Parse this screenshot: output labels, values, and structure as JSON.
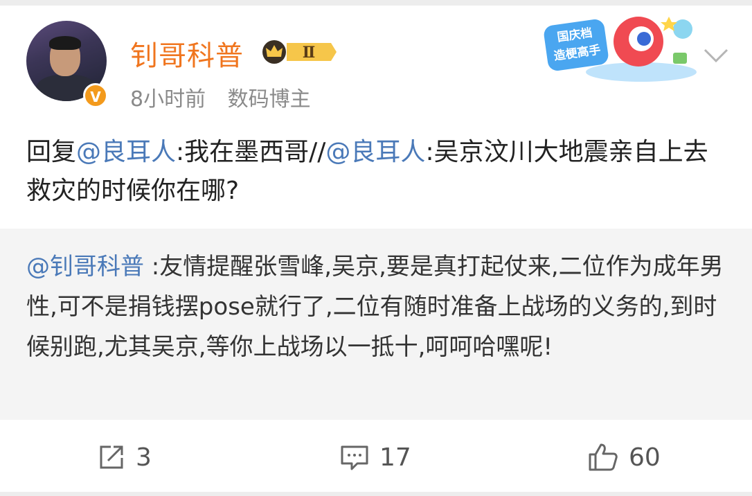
{
  "post": {
    "username": "钊哥科普",
    "vip_level": "Ⅱ",
    "time": "8小时前",
    "source": "数码博主",
    "verified_mark": "V",
    "promo_text_line1": "国庆档",
    "promo_text_line2": "造梗高手",
    "main_prefix": "回复",
    "mention1": "@良耳人",
    "main_part1": ":我在墨西哥//",
    "mention2": "@良耳人",
    "main_part2": ":吴京汶川大地震亲自上去救灾的时候你在哪?",
    "quote_mention": "@钊哥科普",
    "quote_text": " :友情提醒张雪峰,吴京,要是真打起仗来,二位作为成年男性,可不是捐钱摆pose就行了,二位有随时准备上战场的义务的,到时候别跑,尤其吴京,等你上战场以一抵十,呵呵哈嘿呢!"
  },
  "actions": {
    "repost_count": "3",
    "comment_count": "17",
    "like_count": "60"
  },
  "icons": [
    "share-icon",
    "comment-icon",
    "like-icon",
    "chevron-down-icon",
    "vip-crown-icon"
  ],
  "colors": {
    "username": "#f0751e",
    "link": "#4a79b8",
    "quote_bg": "#f4f4f4",
    "meta": "#8a8a8a"
  }
}
